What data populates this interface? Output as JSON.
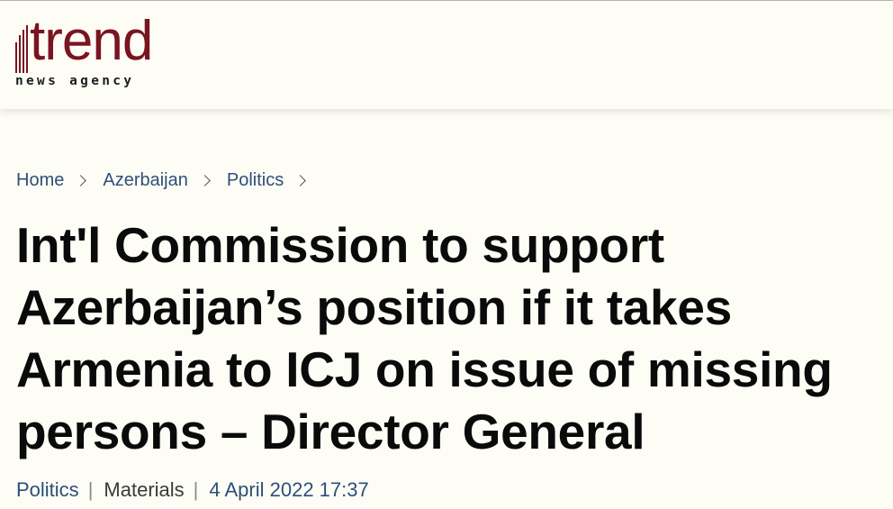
{
  "header": {
    "logo_word": "trend",
    "logo_tagline": "news agency",
    "brand_color": "#7a1420"
  },
  "breadcrumb": [
    {
      "label": "Home"
    },
    {
      "label": "Azerbaijan"
    },
    {
      "label": "Politics"
    }
  ],
  "article": {
    "title": "Int'l Commission to support Azerbaijan’s position if it takes Armenia to ICJ on issue of missing persons – Director General",
    "category": "Politics",
    "type": "Materials",
    "date": "4 April 2022 17:37",
    "separator": "|"
  },
  "colors": {
    "link": "#2e4f78",
    "title": "#0a0a0a",
    "background": "#fdfdf6"
  }
}
